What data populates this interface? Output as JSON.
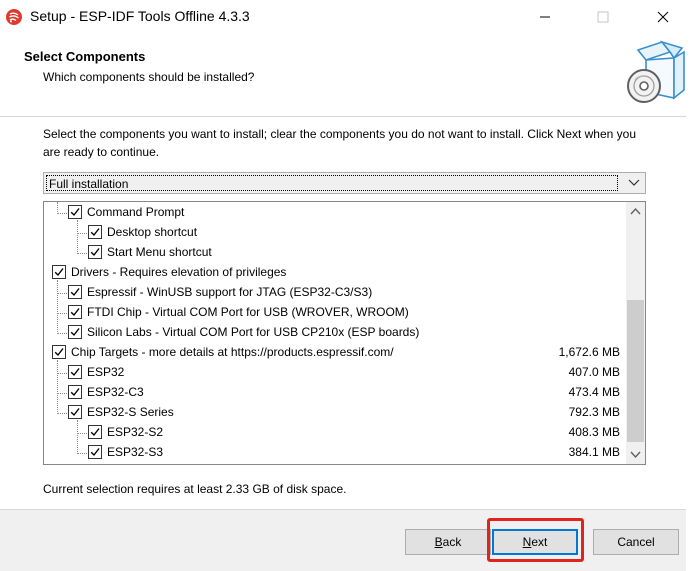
{
  "window": {
    "title": "Setup - ESP-IDF Tools Offline 4.3.3",
    "minimize_icon": "minimize-icon",
    "maximize_icon": "maximize-icon",
    "close_icon": "close-icon"
  },
  "header": {
    "title": "Select Components",
    "subtitle": "Which components should be installed?",
    "icon": "install-box-disc-icon"
  },
  "instructions": "Select the components you want to install; clear the components you do not want to install. Click Next when you are ready to continue.",
  "install_type": {
    "selected": "Full installation"
  },
  "components": [
    {
      "label": "Command Prompt",
      "size": "",
      "checked": true,
      "level": 1
    },
    {
      "label": "Desktop shortcut",
      "size": "",
      "checked": true,
      "level": 2
    },
    {
      "label": "Start Menu shortcut",
      "size": "",
      "checked": true,
      "level": 2
    },
    {
      "label": "Drivers - Requires elevation of privileges",
      "size": "",
      "checked": true,
      "level": 0
    },
    {
      "label": "Espressif - WinUSB support for JTAG (ESP32-C3/S3)",
      "size": "",
      "checked": true,
      "level": 1
    },
    {
      "label": "FTDI Chip - Virtual COM Port for USB (WROVER, WROOM)",
      "size": "",
      "checked": true,
      "level": 1
    },
    {
      "label": "Silicon Labs - Virtual COM Port for USB CP210x (ESP boards)",
      "size": "",
      "checked": true,
      "level": 1
    },
    {
      "label": "Chip Targets - more details at https://products.espressif.com/",
      "size": "1,672.6 MB",
      "checked": true,
      "level": 0
    },
    {
      "label": "ESP32",
      "size": "407.0 MB",
      "checked": true,
      "level": 1
    },
    {
      "label": "ESP32-C3",
      "size": "473.4 MB",
      "checked": true,
      "level": 1
    },
    {
      "label": "ESP32-S Series",
      "size": "792.3 MB",
      "checked": true,
      "level": 1
    },
    {
      "label": "ESP32-S2",
      "size": "408.3 MB",
      "checked": true,
      "level": 2
    },
    {
      "label": "ESP32-S3",
      "size": "384.1 MB",
      "checked": true,
      "level": 2
    }
  ],
  "disk_space": "Current selection requires at least 2.33 GB of disk space.",
  "buttons": {
    "back": "Back",
    "next": "Next",
    "cancel": "Cancel"
  },
  "colors": {
    "highlight": "#e0231c",
    "focus_border": "#0078d7",
    "app_icon": "#e03a2f"
  }
}
